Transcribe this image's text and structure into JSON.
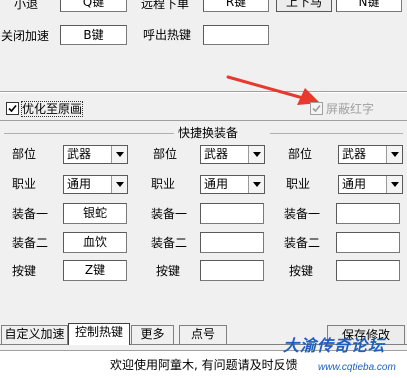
{
  "top_hotkeys": {
    "row1_label_left": "小退",
    "row1_field_left": "Q键",
    "row1_label_right": "远程下单",
    "row1_field_right": "R键",
    "row1_button": "上下马",
    "row1_field_extra": "N键",
    "row2_label_left": "关闭加速",
    "row2_field_left": "B键",
    "row2_label_right": "呼出热键",
    "row2_field_right": ""
  },
  "options": {
    "optimize_label": "优化至原画",
    "optimize_checked": true,
    "block_red_label": "屏蔽红字",
    "block_red_checked": true
  },
  "quick_equip": {
    "title": "快捷换装备",
    "row_labels": {
      "slot": "部位",
      "job": "职业",
      "equip1": "装备一",
      "equip2": "装备二",
      "key": "按键"
    },
    "columns": [
      {
        "slot": "武器",
        "job": "通用",
        "equip1": "银蛇",
        "equip2": "血饮",
        "key": "Z键"
      },
      {
        "slot": "武器",
        "job": "通用",
        "equip1": "",
        "equip2": "",
        "key": ""
      },
      {
        "slot": "武器",
        "job": "通用",
        "equip1": "",
        "equip2": "",
        "key": ""
      }
    ]
  },
  "tabs": [
    "自定义加速",
    "控制热键",
    "更多",
    "点号"
  ],
  "active_tab": "控制热键",
  "save_button": "保存修改",
  "status_text": "欢迎使用阿童木, 有问题请及时反馈",
  "watermark": {
    "title": "大渝传奇论坛",
    "url": "www.cqtieba.com"
  },
  "colors": {
    "arrow": "#e8392f",
    "watermark": "#1d5fbf"
  }
}
